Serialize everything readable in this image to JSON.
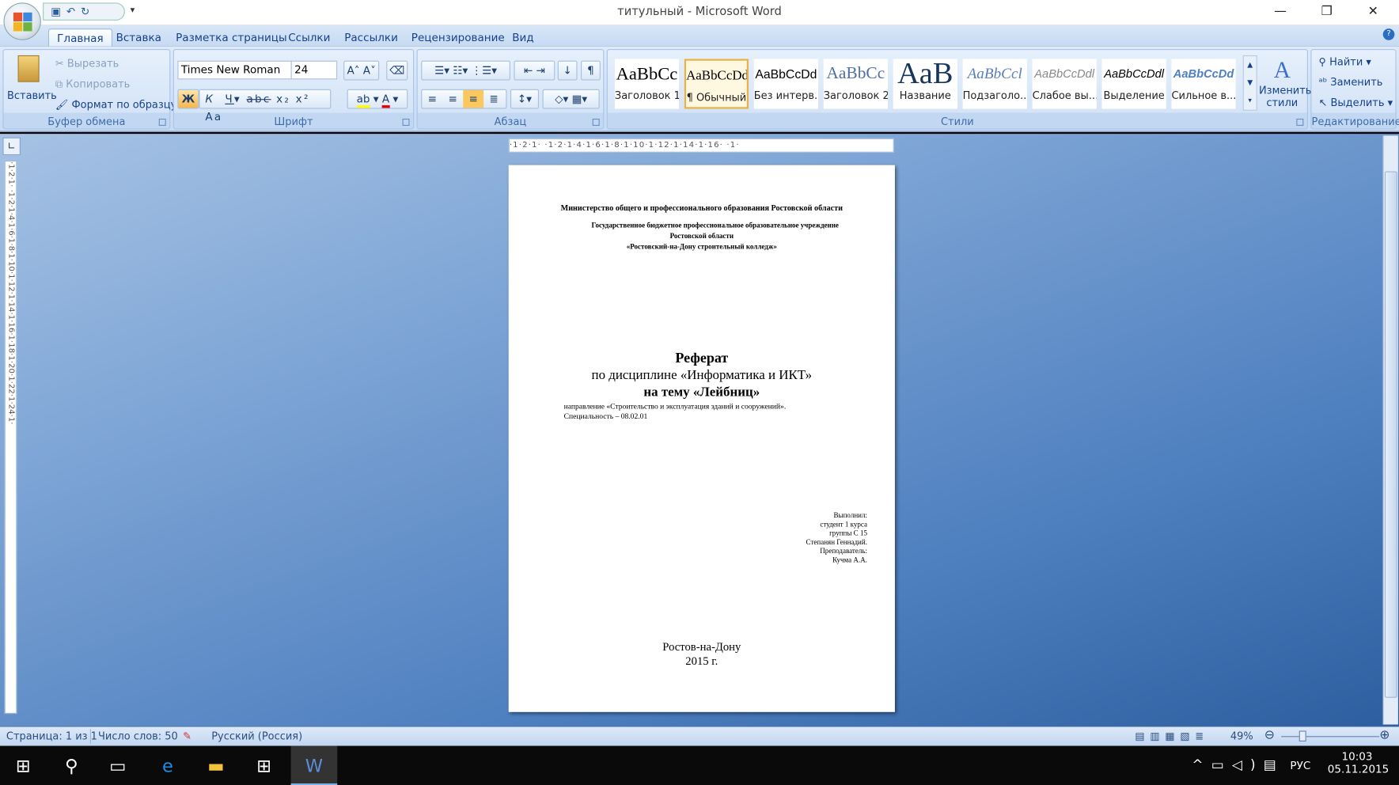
{
  "window": {
    "title": "титульный - Microsoft Word"
  },
  "qat": {
    "icons": [
      "save-icon",
      "undo-icon",
      "redo-icon",
      "customize-icon"
    ]
  },
  "tabs": [
    {
      "label": "Главная",
      "active": true
    },
    {
      "label": "Вставка"
    },
    {
      "label": "Разметка страницы"
    },
    {
      "label": "Ссылки"
    },
    {
      "label": "Рассылки"
    },
    {
      "label": "Рецензирование"
    },
    {
      "label": "Вид"
    }
  ],
  "clipboard": {
    "label": "Буфер обмена",
    "paste": "Вставить",
    "cut": "Вырезать",
    "copy": "Копировать",
    "format_painter": "Формат по образцу"
  },
  "font": {
    "label": "Шрифт",
    "name": "Times New Roman",
    "size": "24",
    "bold": "Ж",
    "italic": "К",
    "underline": "Ч",
    "strike": "abc",
    "sub": "x₂",
    "sup": "x²",
    "case": "Aa",
    "grow": "A˄",
    "shrink": "A˅",
    "highlight_color": "#ffff00",
    "font_color": "#e00000"
  },
  "paragraph": {
    "label": "Абзац",
    "pilcrow": "¶"
  },
  "styles": {
    "label": "Стили",
    "items": [
      {
        "preview": "AaBbCc",
        "name": "Заголовок 1"
      },
      {
        "preview": "AaBbCcDd",
        "name": "¶ Обычный",
        "selected": true
      },
      {
        "preview": "AaBbCcDd",
        "name": "Без интерв..."
      },
      {
        "preview": "AaBbCc",
        "name": "Заголовок 2"
      },
      {
        "preview": "AaB",
        "name": "Название"
      },
      {
        "preview": "AaBbCcl",
        "name": "Подзаголо..."
      },
      {
        "preview": "AaBbCcDdl",
        "name": "Слабое вы..."
      },
      {
        "preview": "AaBbCcDdl",
        "name": "Выделение"
      },
      {
        "preview": "AaBbCcDd",
        "name": "Сильное в..."
      }
    ],
    "change_line1": "Изменить",
    "change_line2": "стили"
  },
  "editing": {
    "label": "Редактирование",
    "find": "Найти",
    "replace": "Заменить",
    "select": "Выделить"
  },
  "ruler": {
    "h": "·1·2·1·  ·1·2·1·4·1·6·1·8·1·10·1·12·1·14·1·16·  ·1·",
    "v": "·1·2·1·  ·1·2·1·4·1·6·1·8·1·10·1·12·1·14·1·16·1·18·1·20·1·22·1·24·1·"
  },
  "document": {
    "ministry": "Министерство  общего и профессионального  образования  Ростовской области",
    "institution": "Государственное  бюджетное  профессиональное  образовательное  учреждение",
    "region": "Ростовской области",
    "college": "«Ростовский-на-Дону  строительный  колледж»",
    "title": "Реферат",
    "discipline": "по дисциплине «Информатика и ИКТ»",
    "topic": "на тему «Лейбниц»",
    "direction": "направление «Строительство и эксплуатация зданий и сооружений».",
    "specialty": "Специальность – 08.02.01",
    "done_by": "Выполнил:",
    "student": "студент 1 курса",
    "group": "группы С 15",
    "student_name": "Степанян Геннадий.",
    "teacher_label": "Преподаватель:",
    "teacher": "Кучма А.А.",
    "city": "Ростов-на-Дону",
    "year": "2015 г."
  },
  "status": {
    "page": "Страница: 1 из 1",
    "words": "Число слов: 50",
    "language": "Русский (Россия)",
    "zoom": "49%",
    "zoom_percent": 49
  },
  "taskbar": {
    "lang": "РУС",
    "time": "10:03",
    "date": "05.11.2015"
  }
}
